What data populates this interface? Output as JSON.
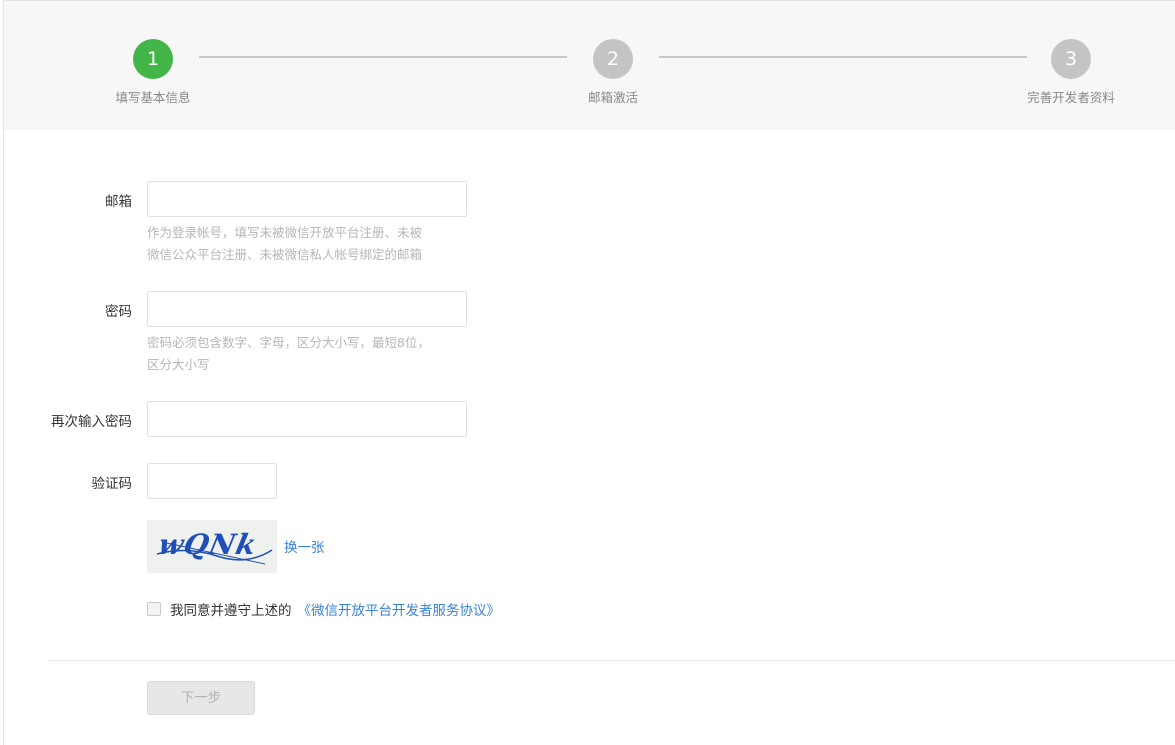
{
  "steps": [
    {
      "number": "1",
      "label": "填写基本信息"
    },
    {
      "number": "2",
      "label": "邮箱激活"
    },
    {
      "number": "3",
      "label": "完善开发者资料"
    }
  ],
  "form": {
    "email": {
      "label": "邮箱",
      "value": "",
      "hint_line1": "作为登录帐号，填写未被微信开放平台注册、未被",
      "hint_line2": "微信公众平台注册、未被微信私人帐号绑定的邮箱"
    },
    "password": {
      "label": "密码",
      "value": "",
      "hint_line1": "密码必须包含数字、字母，区分大小写，最短8位，",
      "hint_line2": "区分大小写"
    },
    "confirm_password": {
      "label": "再次输入密码",
      "value": ""
    },
    "captcha": {
      "label": "验证码",
      "value": "",
      "image_text": "wQNk",
      "refresh_label": "换一张"
    },
    "agreement": {
      "text": "我同意并遵守上述的",
      "link": "《微信开放平台开发者服务协议》",
      "checked": false
    },
    "next_label": "下一步"
  },
  "colors": {
    "active_step": "#44b549",
    "inactive_step": "#c4c4c4",
    "link": "#3a81d8"
  }
}
